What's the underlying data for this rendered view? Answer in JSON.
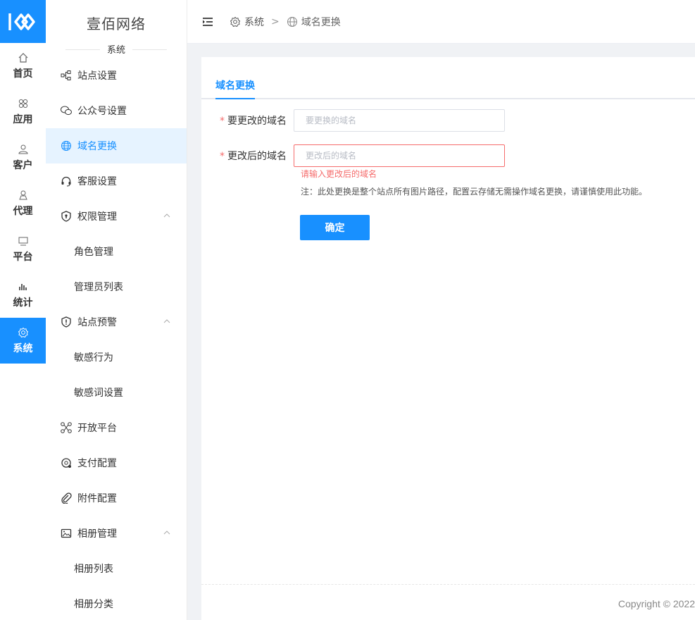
{
  "rail": {
    "logo_icon": "kk-logo-icon",
    "items": [
      {
        "label": "首页",
        "icon": "home-icon"
      },
      {
        "label": "应用",
        "icon": "apps-icon"
      },
      {
        "label": "客户",
        "icon": "user-icon"
      },
      {
        "label": "代理",
        "icon": "agent-icon"
      },
      {
        "label": "平台",
        "icon": "monitor-icon"
      },
      {
        "label": "统计",
        "icon": "bar-chart-icon"
      },
      {
        "label": "系统",
        "icon": "gear-icon",
        "active": true
      }
    ]
  },
  "sidebar": {
    "brand": "壹佰网络",
    "section": "系统",
    "items": [
      {
        "label": "站点设置",
        "icon": "sitemap-icon"
      },
      {
        "label": "公众号设置",
        "icon": "wechat-icon"
      },
      {
        "label": "域名更换",
        "icon": "globe-icon",
        "active": true
      },
      {
        "label": "客服设置",
        "icon": "headset-icon"
      },
      {
        "label": "权限管理",
        "icon": "shield-icon",
        "expanded": true
      },
      {
        "label": "角色管理",
        "child": true
      },
      {
        "label": "管理员列表",
        "child": true
      },
      {
        "label": "站点预警",
        "icon": "shield-alert-icon",
        "expanded": true
      },
      {
        "label": "敏感行为",
        "child": true
      },
      {
        "label": "敏感词设置",
        "child": true
      },
      {
        "label": "开放平台",
        "icon": "share-icon"
      },
      {
        "label": "支付配置",
        "icon": "payment-icon"
      },
      {
        "label": "附件配置",
        "icon": "paperclip-icon"
      },
      {
        "label": "相册管理",
        "icon": "image-icon",
        "expanded": true
      },
      {
        "label": "相册列表",
        "child": true
      },
      {
        "label": "相册分类",
        "child": true
      }
    ]
  },
  "breadcrumb": {
    "items": [
      "系统",
      "域名更换"
    ],
    "separator": ">"
  },
  "content": {
    "tab": "域名更换",
    "form": {
      "old_domain_label": "要更改的域名",
      "old_domain_placeholder": "要更换的域名",
      "old_domain_value": "",
      "new_domain_label": "更改后的域名",
      "new_domain_placeholder": "更改后的域名",
      "new_domain_value": "",
      "error": "请输入更改后的域名",
      "note": "注：此处更换是整个站点所有图片路径，配置云存储无需操作域名更换，请谨慎使用此功能。",
      "submit": "确定",
      "required_mark": "*"
    }
  },
  "footer": {
    "copyright": "Copyright © 2022"
  },
  "colors": {
    "accent": "#1890ff",
    "error": "#f56c6c",
    "active_bg": "#e6f3ff"
  }
}
